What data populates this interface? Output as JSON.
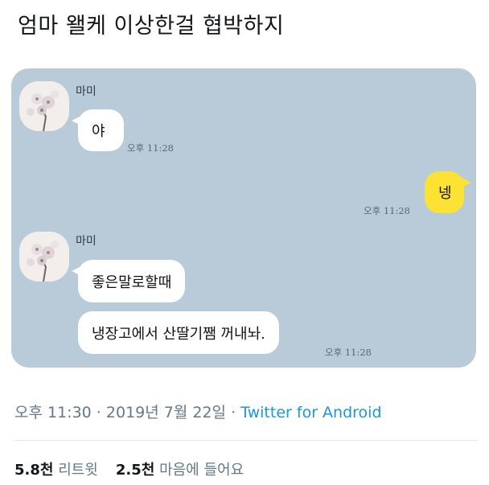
{
  "tweet": {
    "text": "엄마 왤케 이상한걸 협박하지"
  },
  "chat": {
    "messages": [
      {
        "sender": "마미",
        "lines": [
          "야"
        ],
        "time": "오후 11:28"
      },
      {
        "mine": true,
        "text": "넹",
        "time": "오후 11:28"
      },
      {
        "sender": "마미",
        "lines": [
          "좋은말로할때",
          "냉장고에서 산딸기쨈 꺼내놔."
        ],
        "time": "오후 11:28"
      }
    ]
  },
  "meta": {
    "time": "오후 11:30",
    "sep1": " · ",
    "date": "2019년 7월 22일",
    "sep2": " · ",
    "source": "Twitter for Android"
  },
  "stats": {
    "retweets_count": "5.8천",
    "retweets_label": "리트윗",
    "likes_count": "2.5천",
    "likes_label": "마음에 들어요"
  },
  "colors": {
    "chat_background": "#b9cad8",
    "my_bubble": "#fbe233",
    "link": "#1b95e0"
  },
  "icons": [
    "avatar-flower-photo"
  ]
}
